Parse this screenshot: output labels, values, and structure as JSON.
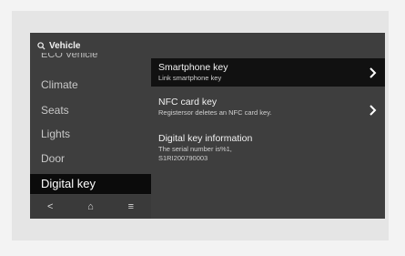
{
  "search": {
    "label": "Vehicle"
  },
  "menu": {
    "items": [
      {
        "label": "ECO Vehicle"
      },
      {
        "label": "Climate"
      },
      {
        "label": "Seats"
      },
      {
        "label": "Lights"
      },
      {
        "label": "Door"
      },
      {
        "label": "Digital key"
      }
    ]
  },
  "bottom_bar": {
    "back_glyph": "<",
    "home_glyph": "⌂",
    "menu_glyph": "≡"
  },
  "content": {
    "rows": [
      {
        "title": "Smartphone key",
        "subtitle": "Link smartphone key"
      },
      {
        "title": "NFC card key",
        "subtitle": "Registersor deletes an NFC card key."
      },
      {
        "title": "Digital key information",
        "subtitle_line1": "The serial number is%1,",
        "subtitle_line2": "S1RI200790003"
      }
    ]
  },
  "colors": {
    "screen_bg": "#3e3e3e",
    "active_bg": "#0b0b0b",
    "frame_bg": "#e5e5e5",
    "page_bg": "#f3f3f3"
  },
  "icons": {
    "search": "search-icon",
    "chevron": "chevron-right-icon",
    "back": "back-icon",
    "home": "home-icon",
    "menu": "menu-icon"
  }
}
